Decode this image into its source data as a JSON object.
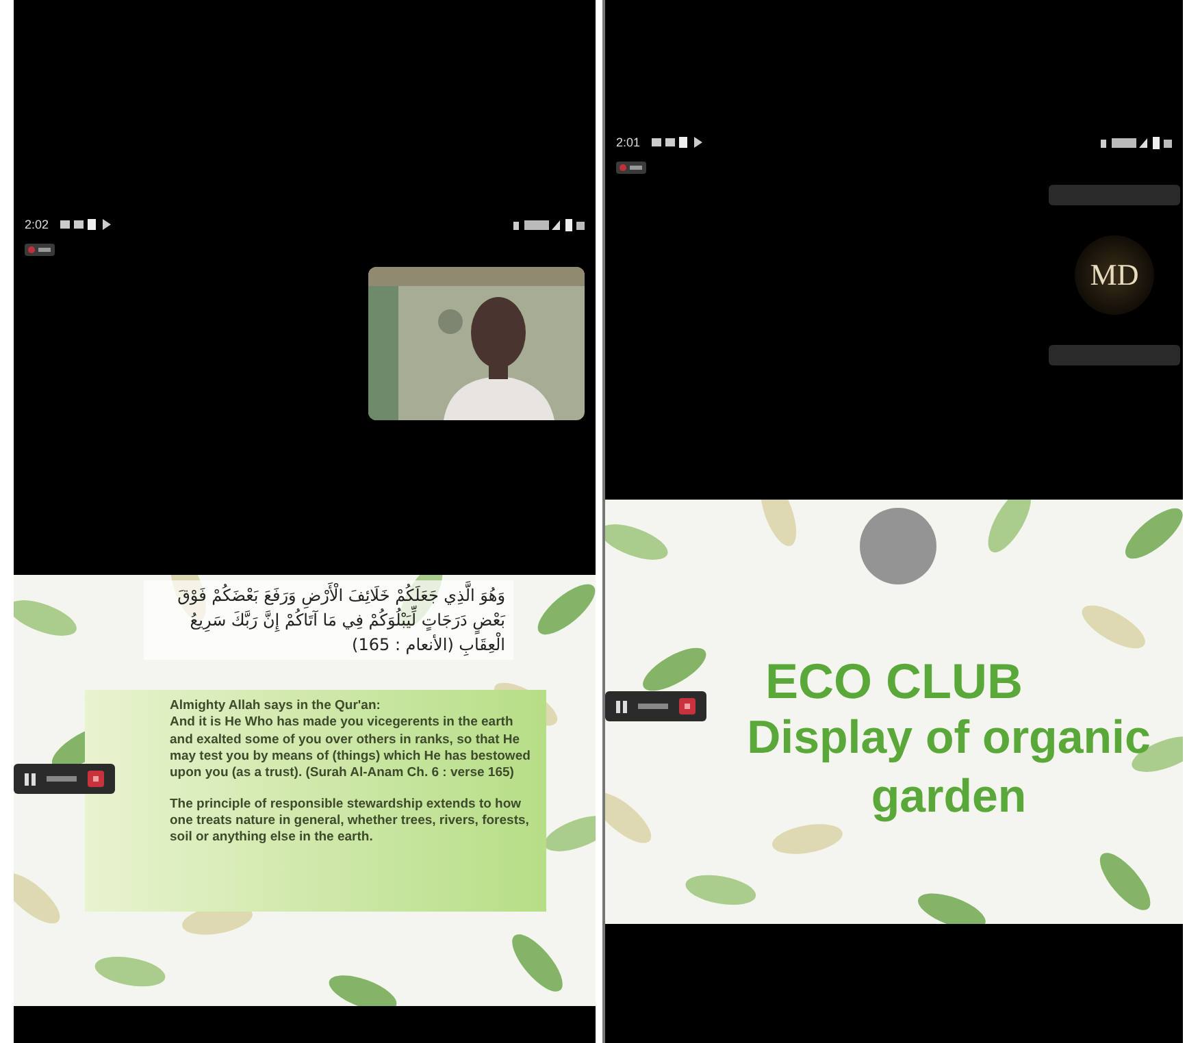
{
  "left_screen": {
    "status_bar": {
      "time": "2:02"
    },
    "slide": {
      "arabic_verse": "وَهُوَ الَّذِي جَعَلَكُمْ خَلَائِفَ الْأَرْضِ وَرَفَعَ بَعْضَكُمْ فَوْقَ بَعْضٍ دَرَجَاتٍ لِّيَبْلُوَكُمْ فِي مَا آتَاكُمْ إِنَّ رَبَّكَ سَرِيعُ الْعِقَابِ (الأنعام : 165)",
      "heading": "Almighty Allah says in the Qur'an:",
      "paragraphs": [
        "And it is He Who has made you vicegerents in the earth and exalted some of you over others in ranks, so that He may test you by means of (things) which He has bestowed upon you (as a trust). (Surah Al-Anam Ch. 6 : verse 165)",
        "The principle of responsible stewardship extends to how one treats nature in general, whether trees, rivers, forests, soil or anything else in the earth."
      ]
    }
  },
  "right_screen": {
    "status_bar": {
      "time": "2:01"
    },
    "logo": "MD",
    "slide": {
      "title": "ECO CLUB",
      "subtitle": "Display of organic garden"
    }
  }
}
